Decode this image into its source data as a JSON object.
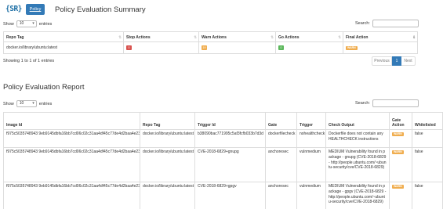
{
  "header": {
    "logo_text": "{SR}",
    "policy_button": "Policy",
    "title": "Policy Evaluation Summary"
  },
  "summary": {
    "show_label": "Show",
    "entries_value": "10",
    "entries_label": "entries",
    "search_label": "Search:",
    "columns": [
      "Repo Tag",
      "Stop Actions",
      "Warn Actions",
      "Go Actions",
      "Final Action"
    ],
    "row": {
      "repo_tag": "docker.io/library/ubuntu:latest",
      "stop": "0",
      "warn": "19",
      "go": "0",
      "final": "WARN"
    },
    "info": "Showing 1 to 1 of 1 entries",
    "pager": {
      "prev": "Previous",
      "current": "1",
      "next": "Next"
    }
  },
  "report": {
    "title": "Policy Evaluation Report",
    "show_label": "Show",
    "entries_value": "10",
    "entries_label": "entries",
    "search_label": "Search:",
    "columns": {
      "image_id": "Image Id",
      "repo_tag": "Repo Tag",
      "trigger_id": "Trigger Id",
      "gate": "Gate",
      "trigger": "Trigger",
      "check_output": "Check Output",
      "gate_action_1": "Gate",
      "gate_action_2": "Action",
      "whitelisted": "Whitelisted"
    },
    "rows": [
      {
        "image_id": "f975c5035748943 9eb9145dbfa16bb7cd06c02c31aa4df45c77de4d2baa4e232",
        "repo_tag": "docker.io/library/ubuntu:latest",
        "trigger_id": "b38090bac771995c5af3fcfb033b7d3d",
        "gate": "dockerfilecheck",
        "trigger": "nohealthcheck",
        "check_output": "Dockerfile does not contain any HEALTHCHECK instructions",
        "action": "WARN",
        "whitelisted": "false"
      },
      {
        "image_id": "f975c5035748943 9eb9145dbfa16bb7cd06c02c31aa4df45c77de4d2baa4e232",
        "repo_tag": "docker.io/library/ubuntu:latest",
        "trigger_id": "CVE-2018-6829+gnupg",
        "gate": "anchoresec",
        "trigger": "vulnmedium",
        "check_output": "MEDIUM Vulnerability found in package - gnupg (CVE-2018-6829 - http://people.ubuntu.com/~ubuntu-security/cve/CVE-2018-6829)",
        "action": "WARN",
        "whitelisted": "false"
      },
      {
        "image_id": "f975c5035748943 9eb9145dbfa16bb7cd06c02c31aa4df45c77de4d2baa4e232",
        "repo_tag": "docker.io/library/ubuntu:latest",
        "trigger_id": "CVE-2018-6829+gpgv",
        "gate": "anchoresec",
        "trigger": "vulnmedium",
        "check_output": "MEDIUM Vulnerability found in package - gpgv (CVE-2018-6829 - http://people.ubuntu.com/~ubuntu-security/cve/CVE-2018-6829)",
        "action": "WARN",
        "whitelisted": "false"
      }
    ]
  }
}
